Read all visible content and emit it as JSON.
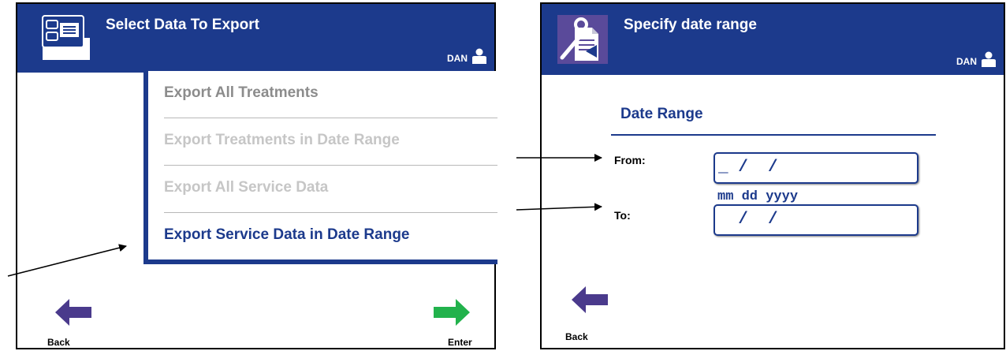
{
  "left_screen": {
    "title": "Select Data To Export",
    "user": "DAN",
    "menu_items": [
      {
        "label": "Export All Treatments",
        "state": "enabled-grey"
      },
      {
        "label": "Export Treatments in Date Range",
        "state": "disabled"
      },
      {
        "label": "Export All Service Data",
        "state": "disabled"
      },
      {
        "label": "Export Service Data in Date Range",
        "state": "selected"
      }
    ],
    "back_label": "Back",
    "enter_label": "Enter"
  },
  "right_screen": {
    "title": "Specify date range",
    "user": "DAN",
    "section_title": "Date Range",
    "from_label": "From:",
    "from_value": "_ /  /",
    "format_hint": "mm dd yyyy",
    "to_label": "To:",
    "to_value": "  /  /",
    "back_label": "Back"
  },
  "colors": {
    "title_bar": "#1c3a8c",
    "accent": "#1c3a8c",
    "back_arrow": "#4a3a8c",
    "enter_arrow": "#22b24c"
  }
}
